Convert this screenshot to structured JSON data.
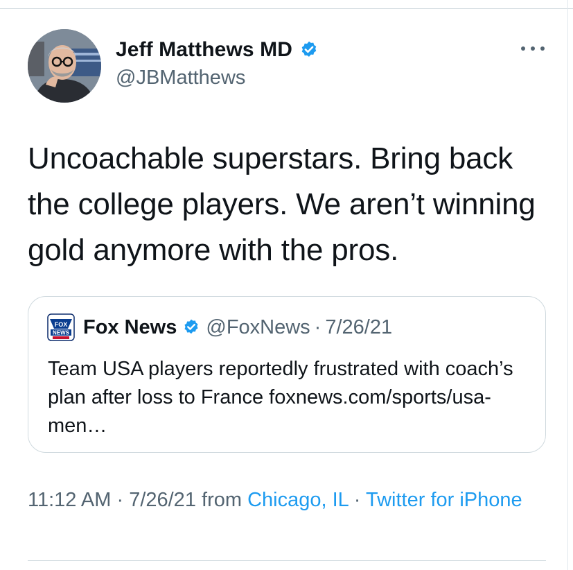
{
  "author": {
    "display_name": "Jeff Matthews MD",
    "handle": "@JBMatthews",
    "verified": true,
    "avatar_icon": "profile-photo"
  },
  "tweet": {
    "text": "Uncoachable superstars. Bring back the college players. We aren’t winning gold anymore with the pros.",
    "more_icon": "ellipsis-icon"
  },
  "quoted_tweet": {
    "logo_icon": "fox-news-logo",
    "display_name": "Fox News",
    "verified": true,
    "handle": "@FoxNews",
    "separator": "·",
    "date": "7/26/21",
    "text": "Team USA players reportedly frustrated with coach’s plan after loss to France foxnews.com/sports/usa-men…"
  },
  "meta": {
    "time": "11:12 AM",
    "separator_1": "·",
    "date": "7/26/21",
    "from_label": "from",
    "location": "Chicago, IL",
    "separator_2": "·",
    "source": "Twitter for iPhone"
  },
  "colors": {
    "link": "#1d9bf0",
    "secondary_text": "#536471",
    "primary_text": "#0f1419",
    "border": "#cfd9de"
  }
}
